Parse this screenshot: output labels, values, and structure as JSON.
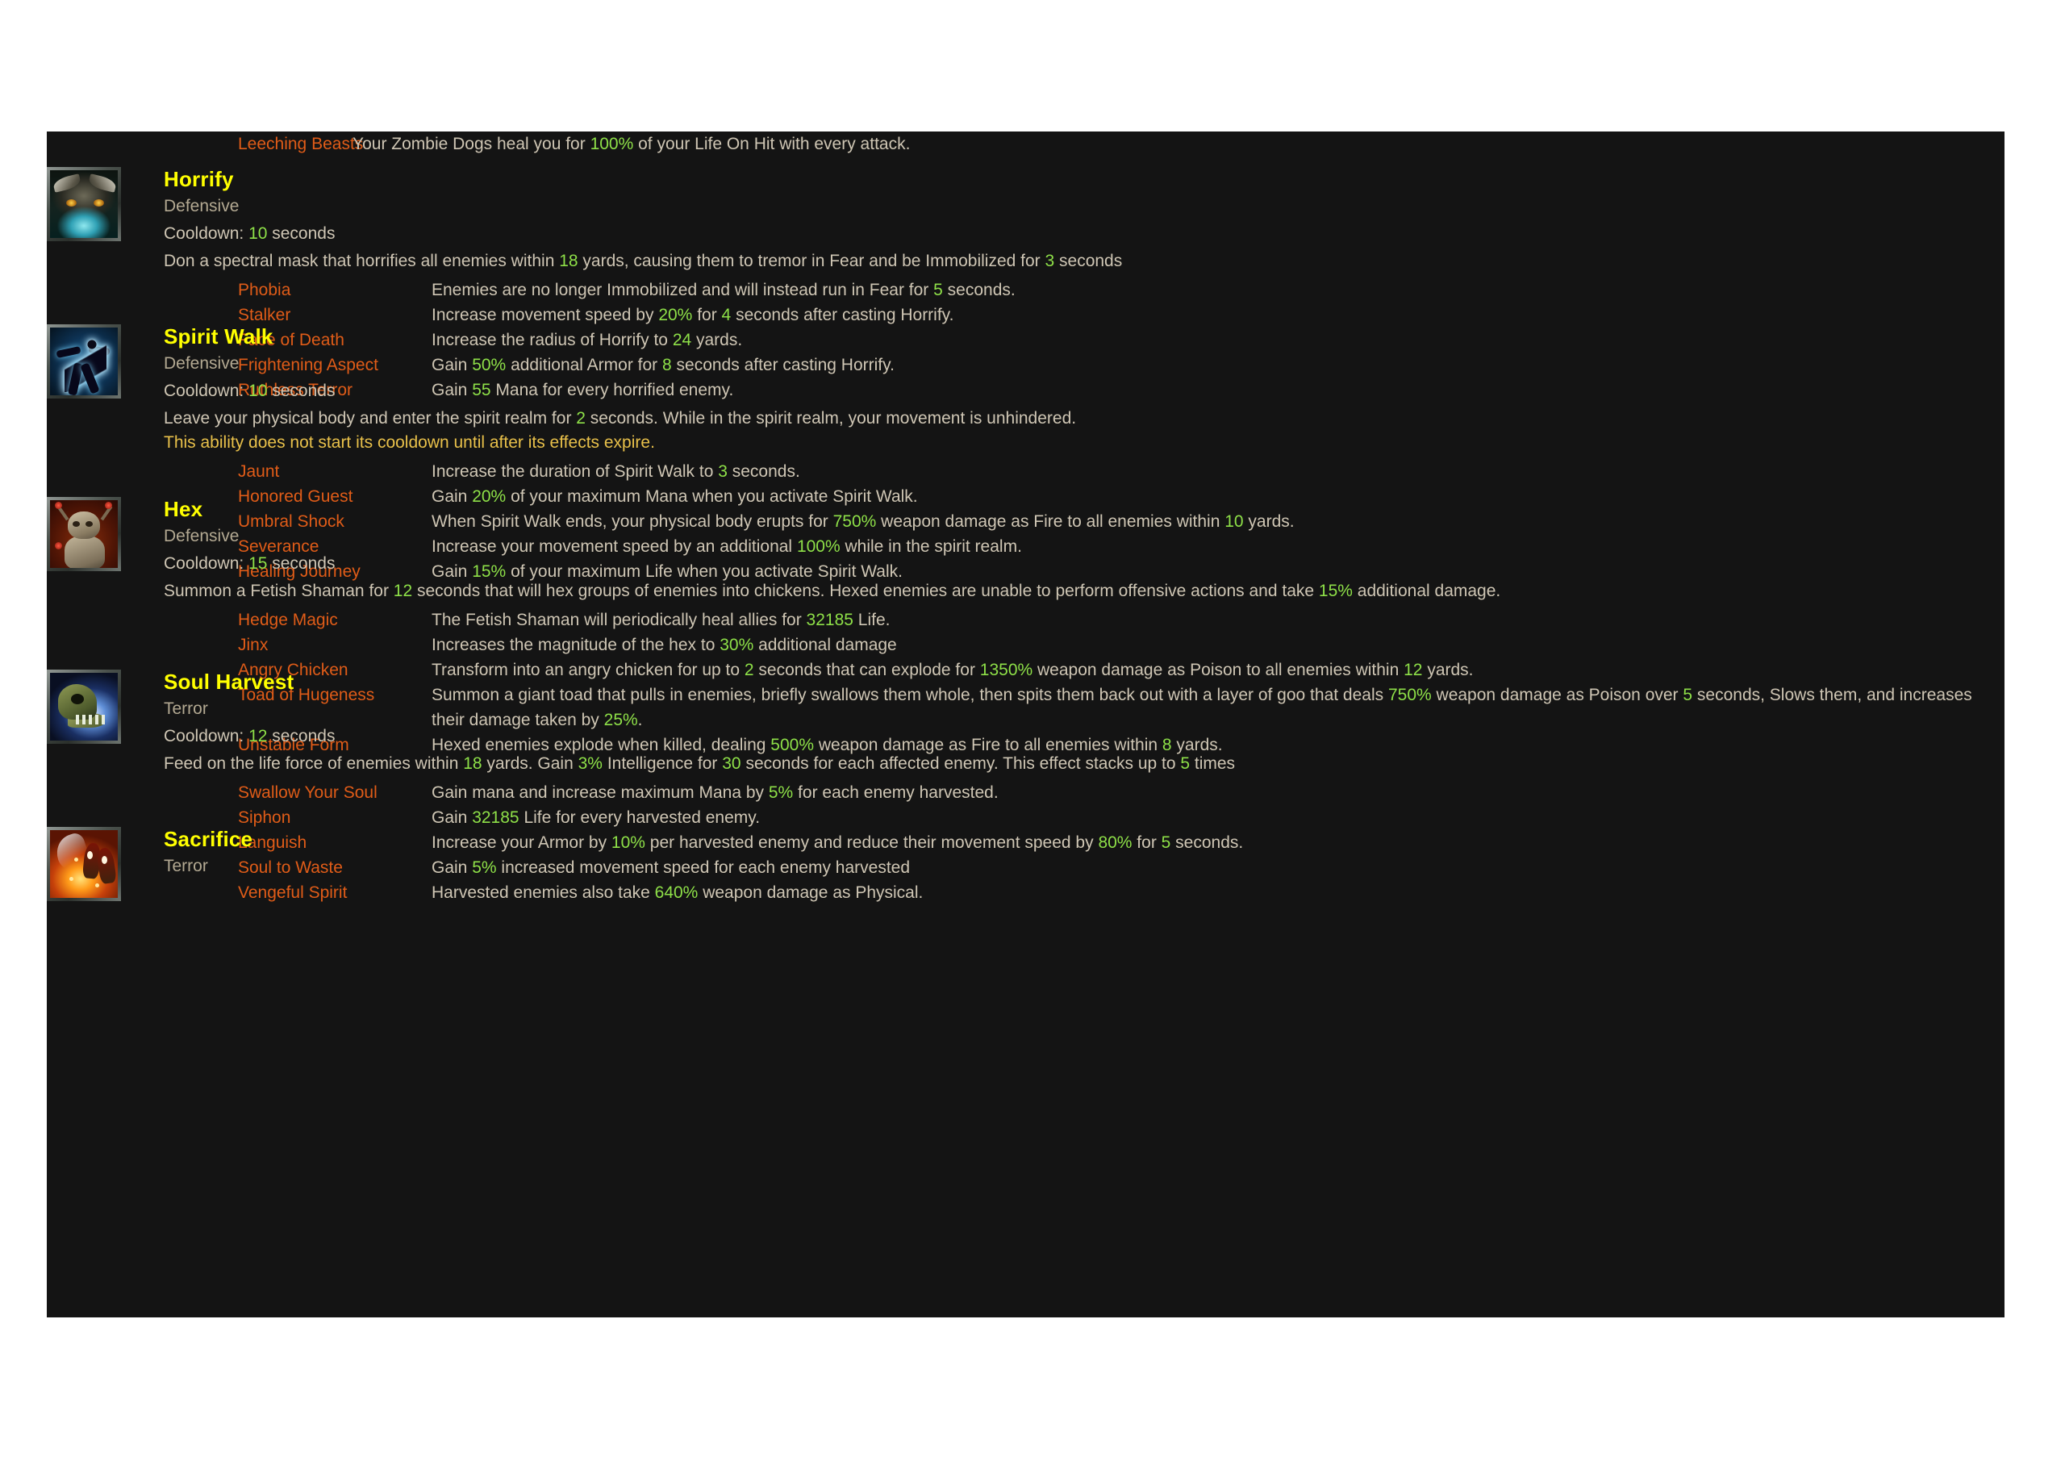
{
  "panel": {
    "background_color": "#141414",
    "page_background": "#ffffff"
  },
  "colors": {
    "skill_name": "#ffff00",
    "rune_name": "#e05c18",
    "body_text": "#cfc6b4",
    "highlight_number": "#8ee048",
    "note_text": "#e8c04a",
    "category_text": "#b3a992"
  },
  "orphan_rune": {
    "name": "Leeching Beasts",
    "desc_pre": "Your Zombie Dogs heal you for ",
    "desc_hl": "100%",
    "desc_post": " of your Life On Hit with every attack."
  },
  "skills": [
    {
      "name": "Horrify",
      "icon": "horrify-icon",
      "category": "Defensive",
      "cooldown_label": "Cooldown: ",
      "cooldown_value": "10",
      "cooldown_unit": " seconds",
      "description": "Don a spectral mask that horrifies all enemies within 18 yards, causing them to tremor in Fear and be Immobilized for 3 seconds",
      "note": "",
      "runes": [
        {
          "name": "Phobia",
          "desc": "Enemies are no longer Immobilized and will instead run in Fear for 5 seconds."
        },
        {
          "name": "Stalker",
          "desc": "Increase movement speed by 20% for 4 seconds after casting Horrify."
        },
        {
          "name": "Face of Death",
          "desc": "Increase the radius of Horrify to 24 yards."
        },
        {
          "name": "Frightening Aspect",
          "desc": "Gain 50% additional Armor for 8 seconds after casting Horrify."
        },
        {
          "name": "Ruthless Terror",
          "desc": "Gain 55 Mana for every horrified enemy."
        }
      ]
    },
    {
      "name": "Spirit Walk",
      "icon": "spirit-walk-icon",
      "category": "Defensive",
      "cooldown_label": "Cooldown: ",
      "cooldown_value": "10",
      "cooldown_unit": " seconds",
      "description": "Leave your physical body and enter the spirit realm for 2 seconds. While in the spirit realm, your movement is unhindered.",
      "note": "This ability does not start its cooldown until after its effects expire.",
      "runes": [
        {
          "name": "Jaunt",
          "desc": "Increase the duration of Spirit Walk to 3 seconds."
        },
        {
          "name": "Honored Guest",
          "desc": "Gain 20% of your maximum Mana when you activate Spirit Walk."
        },
        {
          "name": "Umbral Shock",
          "desc": "When Spirit Walk ends, your physical body erupts for 750% weapon damage as Fire to all enemies within 10 yards."
        },
        {
          "name": "Severance",
          "desc": "Increase your movement speed by an additional 100% while in the spirit realm."
        },
        {
          "name": "Healing Journey",
          "desc": "Gain 15% of your maximum Life when you activate Spirit Walk."
        }
      ]
    },
    {
      "name": "Hex",
      "icon": "hex-icon",
      "category": "Defensive",
      "cooldown_label": "Cooldown: ",
      "cooldown_value": "15",
      "cooldown_unit": " seconds",
      "description": "Summon a Fetish Shaman for 12 seconds that will hex groups of enemies into chickens. Hexed enemies are unable to perform offensive actions and take 15% additional damage.",
      "note": "",
      "runes": [
        {
          "name": "Hedge Magic",
          "desc": "The Fetish Shaman will periodically heal allies for 32185 Life."
        },
        {
          "name": "Jinx",
          "desc": "Increases the magnitude of the hex to 30% additional damage"
        },
        {
          "name": "Angry Chicken",
          "desc": "Transform into an angry chicken for up to 2 seconds that can explode for 1350% weapon damage as Poison to all enemies within 12 yards."
        },
        {
          "name": "Toad of Hugeness",
          "desc": "Summon a giant toad that pulls in enemies, briefly swallows them whole, then spits them back out with a layer of goo that deals 750% weapon damage as Poison over 5 seconds, Slows them, and increases their damage taken by 25%."
        },
        {
          "name": "Unstable Form",
          "desc": "Hexed enemies explode when killed, dealing 500% weapon damage as Fire to all enemies within 8 yards."
        }
      ]
    },
    {
      "name": "Soul Harvest",
      "icon": "soul-harvest-icon",
      "category": "Terror",
      "cooldown_label": "Cooldown: ",
      "cooldown_value": "12",
      "cooldown_unit": " seconds",
      "description": "Feed on the life force of enemies within 18 yards. Gain 3% Intelligence for 30 seconds for each affected enemy. This effect stacks up to 5 times",
      "note": "",
      "runes": [
        {
          "name": "Swallow Your Soul",
          "desc": "Gain mana and increase maximum Mana by 5% for each enemy harvested."
        },
        {
          "name": "Siphon",
          "desc": "Gain 32185 Life for every harvested enemy."
        },
        {
          "name": "Languish",
          "desc": "Increase your Armor by 10% per harvested enemy and reduce their movement speed by 80% for 5 seconds."
        },
        {
          "name": "Soul to Waste",
          "desc": "Gain 5% increased movement speed for each enemy harvested"
        },
        {
          "name": "Vengeful Spirit",
          "desc": "Harvested enemies also take 640% weapon damage as Physical."
        }
      ]
    },
    {
      "name": "Sacrifice",
      "icon": "sacrifice-icon",
      "category": "Terror",
      "cooldown_label": "",
      "cooldown_value": "",
      "cooldown_unit": "",
      "description": "",
      "note": "",
      "runes": []
    }
  ]
}
